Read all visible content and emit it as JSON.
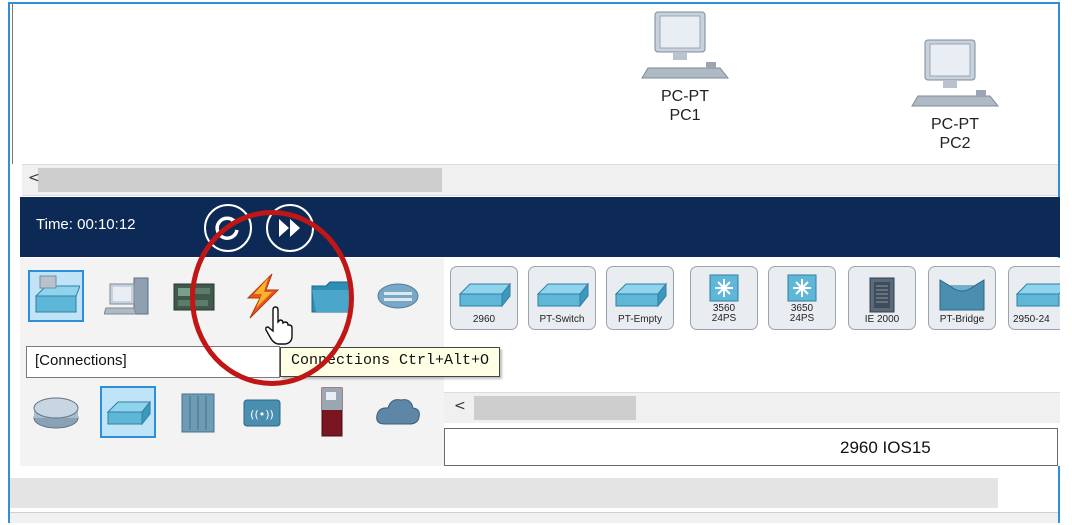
{
  "workspace": {
    "devices": [
      {
        "type_label": "PC-PT",
        "name_label": "PC1"
      },
      {
        "type_label": "PC-PT",
        "name_label": "PC2"
      }
    ],
    "scroll_left_glyph": "<"
  },
  "timebar": {
    "time_text": "Time: 00:10:12"
  },
  "device_categories": {
    "row1": [
      {
        "icon": "network-devices-icon",
        "selected": true
      },
      {
        "icon": "end-devices-icon",
        "selected": false
      },
      {
        "icon": "components-icon",
        "selected": false
      },
      {
        "icon": "connections-lightning-icon",
        "selected": false
      },
      {
        "icon": "miscellaneous-folder-icon",
        "selected": false
      },
      {
        "icon": "multiuser-cloud-icon",
        "selected": false
      }
    ],
    "row2": [
      {
        "icon": "router-icon",
        "selected": false
      },
      {
        "icon": "switch-icon",
        "selected": true
      },
      {
        "icon": "hub-icon",
        "selected": false
      },
      {
        "icon": "wireless-icon",
        "selected": false
      },
      {
        "icon": "security-icon",
        "selected": false
      },
      {
        "icon": "wan-emulation-cloud-icon",
        "selected": false
      }
    ],
    "category_label": "[Connections]"
  },
  "tooltip": {
    "text": "Connections Ctrl+Alt+O"
  },
  "device_list": {
    "items": [
      {
        "label": "2960",
        "overlay": ""
      },
      {
        "label": "PT-Switch",
        "overlay": ""
      },
      {
        "label": "PT-Empty",
        "overlay": ""
      },
      {
        "label": "",
        "overlay": "3560\n24PS"
      },
      {
        "label": "",
        "overlay": "3650\n24PS"
      },
      {
        "label": "IE 2000",
        "overlay": ""
      },
      {
        "label": "PT-Bridge",
        "overlay": ""
      },
      {
        "label": "2950-24",
        "overlay": ""
      }
    ],
    "scroll_left_glyph": "<",
    "selected_model": "2960 IOS15"
  },
  "colors": {
    "timebar": "#0c2a55",
    "frame_border": "#2f8fd8",
    "annotation_circle": "#c01616",
    "tooltip_bg": "#ffffe6"
  }
}
